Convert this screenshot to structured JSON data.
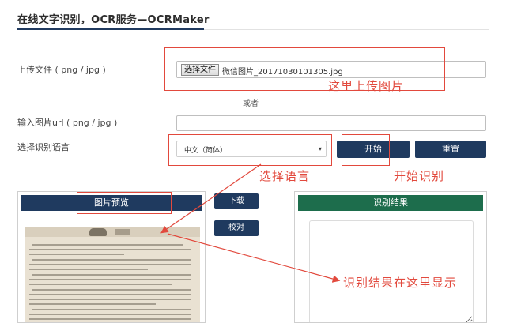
{
  "header": {
    "title": "在线文字识别，OCR服务—OCRMaker"
  },
  "upload": {
    "label": "上传文件 ( png / jpg )",
    "button_label": "选择文件",
    "file_name": "微信图片_20171030101305.jpg"
  },
  "divider_text": "或者",
  "url_input": {
    "label": "输入图片url ( png / jpg )",
    "value": ""
  },
  "language": {
    "label": "选择识别语言",
    "selected": "中文（简体）",
    "caret": "▾"
  },
  "buttons": {
    "start": "开始",
    "reset": "重置",
    "download": "下载",
    "proofread": "校对"
  },
  "preview": {
    "title": "图片预览"
  },
  "result": {
    "title": "识别结果",
    "text": ""
  },
  "annotations": {
    "upload_hint": "这里上传图片",
    "language_hint": "选择语言",
    "start_hint": "开始识别",
    "result_hint": "识别结果在这里显示",
    "color": "#e2493d"
  },
  "colors": {
    "navy": "#1f3a5f",
    "green": "#1d6d4c"
  }
}
